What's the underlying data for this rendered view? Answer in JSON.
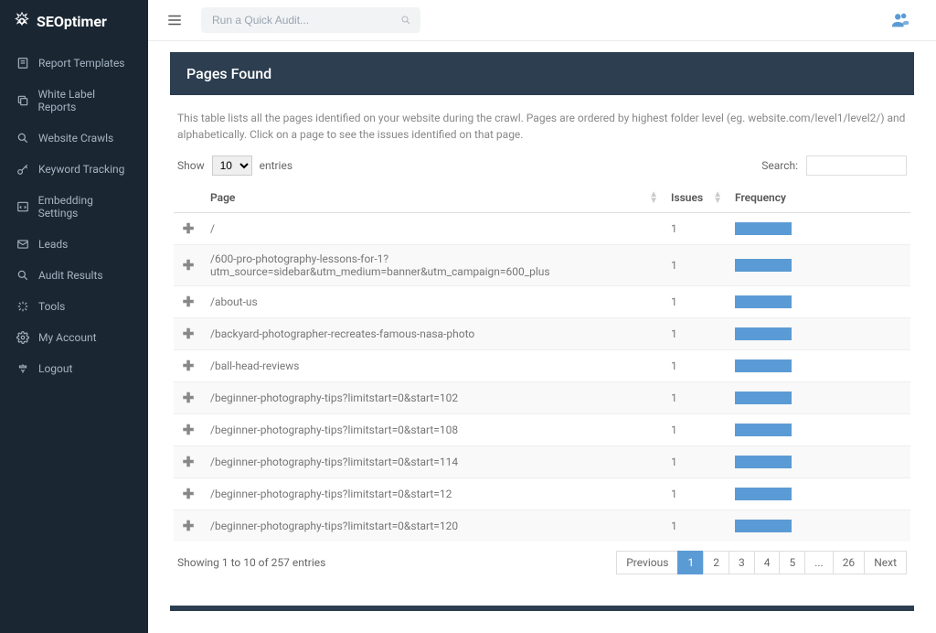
{
  "brand": "SEOptimer",
  "topbar": {
    "quick_audit_placeholder": "Run a Quick Audit..."
  },
  "sidebar": {
    "items": [
      {
        "label": "Report Templates"
      },
      {
        "label": "White Label Reports"
      },
      {
        "label": "Website Crawls"
      },
      {
        "label": "Keyword Tracking"
      },
      {
        "label": "Embedding Settings"
      },
      {
        "label": "Leads"
      },
      {
        "label": "Audit Results"
      },
      {
        "label": "Tools"
      },
      {
        "label": "My Account"
      },
      {
        "label": "Logout"
      }
    ]
  },
  "panel": {
    "title": "Pages Found",
    "desc": "This table lists all the pages identified on your website during the crawl. Pages are ordered by highest folder level (eg. website.com/level1/level2/) and alphabetically. Click on a page to see the issues identified on that page."
  },
  "controls": {
    "show_prefix": "Show",
    "show_value": "10",
    "show_suffix": "entries",
    "search_label": "Search:"
  },
  "columns": {
    "page": "Page",
    "issues": "Issues",
    "frequency": "Frequency"
  },
  "rows": [
    {
      "page": "/",
      "issues": "1"
    },
    {
      "page": "/600-pro-photography-lessons-for-1?utm_source=sidebar&utm_medium=banner&utm_campaign=600_plus",
      "issues": "1"
    },
    {
      "page": "/about-us",
      "issues": "1"
    },
    {
      "page": "/backyard-photographer-recreates-famous-nasa-photo",
      "issues": "1"
    },
    {
      "page": "/ball-head-reviews",
      "issues": "1"
    },
    {
      "page": "/beginner-photography-tips?limitstart=0&start=102",
      "issues": "1"
    },
    {
      "page": "/beginner-photography-tips?limitstart=0&start=108",
      "issues": "1"
    },
    {
      "page": "/beginner-photography-tips?limitstart=0&start=114",
      "issues": "1"
    },
    {
      "page": "/beginner-photography-tips?limitstart=0&start=12",
      "issues": "1"
    },
    {
      "page": "/beginner-photography-tips?limitstart=0&start=120",
      "issues": "1"
    }
  ],
  "footer": {
    "info": "Showing 1 to 10 of 257 entries",
    "pages": [
      "Previous",
      "1",
      "2",
      "3",
      "4",
      "5",
      "...",
      "26",
      "Next"
    ]
  }
}
